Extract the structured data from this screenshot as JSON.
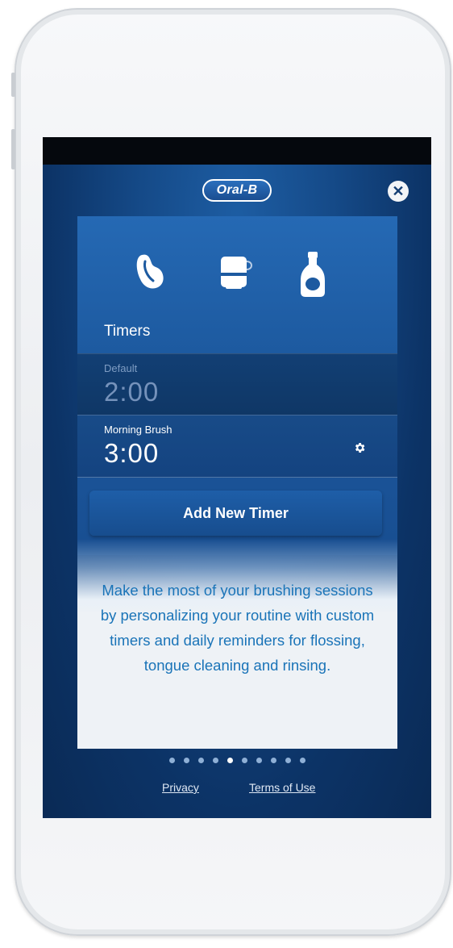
{
  "app": {
    "logo_text": "Oral-B",
    "close_icon": "close-circle-icon",
    "brand_color": "#1a74b8"
  },
  "icons": [
    "tongue-cleaner-icon",
    "floss-dispenser-icon",
    "mouthwash-bottle-icon"
  ],
  "timers": {
    "section_title": "Timers",
    "items": [
      {
        "name": "Default",
        "time": "2:00"
      },
      {
        "name": "Morning Brush",
        "time": "3:00",
        "settings_icon": "gear-icon"
      }
    ],
    "add_button_label": "Add New Timer"
  },
  "promo_text": "Make the most of your brushing sessions by personalizing your routine with custom timers and daily reminders for flossing, tongue cleaning and rinsing.",
  "pagination": {
    "total": 10,
    "active_index": 4
  },
  "footer": {
    "privacy_label": "Privacy",
    "terms_label": "Terms of Use"
  }
}
